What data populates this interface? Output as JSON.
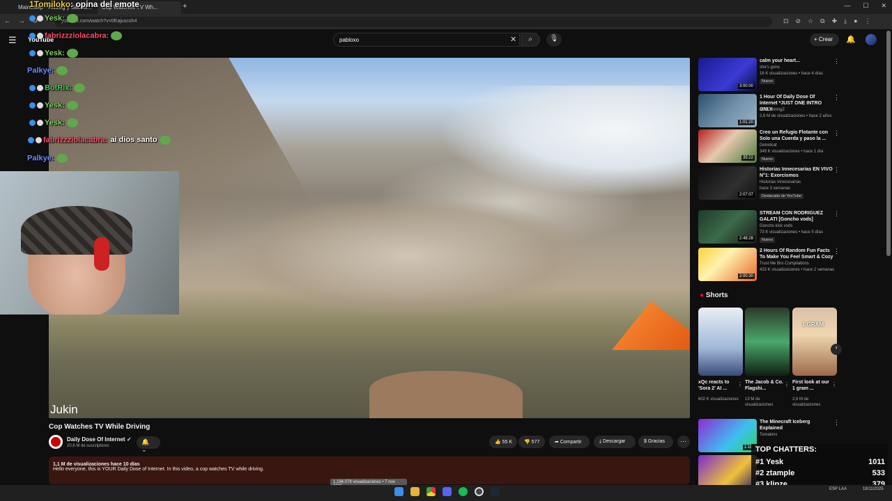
{
  "browser": {
    "tab1": "Maincitiep - Rizzeg y Sacha...",
    "tab2": "Cop Watches TV Wh...",
    "new_tab": "+",
    "url": "youtube.com/watch?v=0Eajuxcoh4",
    "window_controls": [
      "—",
      "☐",
      "✕"
    ]
  },
  "youtube": {
    "logo": "YouTube",
    "search_value": "pabloxo",
    "create_label": "Crear"
  },
  "chat": {
    "title_line": {
      "user": "1Tomiloko",
      "msg": "opina del emote"
    },
    "lines": [
      {
        "user": "Yesk:",
        "color": "#7fd05c"
      },
      {
        "user": "fabrizzziolacabra:",
        "color": "#ff4f6a"
      },
      {
        "user": "Yesk:",
        "color": "#7fd05c"
      },
      {
        "user": "Palkye:",
        "color": "#6b8cff"
      },
      {
        "user": "BotRix:",
        "color": "#4ecb58"
      },
      {
        "user": "Yesk:",
        "color": "#7fd05c"
      },
      {
        "user": "Yesk:",
        "color": "#7fd05c"
      },
      {
        "user": "fabrizzziolacabra:",
        "color": "#ff4f6a",
        "msg": "ai dios santo"
      },
      {
        "user": "Palkye:",
        "color": "#6b8cff"
      }
    ]
  },
  "video": {
    "watermark": "Jukin",
    "title": "Cop Watches TV While Driving",
    "channel": "Daily Dose Of Internet",
    "subs": "20,6 M de suscriptores",
    "likes": "55 K",
    "dislikes": "577",
    "share": "Compartir",
    "download": "Descargar",
    "thanks": "Gracias",
    "desc_views": "1,1 M de visualizaciones  hace 10 días",
    "desc_text": "Hello everyone, this is YOUR Daily Dose of Internet. In this video, a cop watches TV while driving.",
    "tooltip": "1.194.079 visualizaciones • 7 nov 2025"
  },
  "recs": [
    {
      "title": "calm your heart...",
      "channel": "she's gone",
      "meta": "16 K visualizaciones • hace 4 días",
      "badge": "Nuevo",
      "dur": "3:00:00",
      "bg": "linear-gradient(135deg,#1a1a8f,#3b3bd6 60%,#0a0a40)"
    },
    {
      "title": "1 Hour Of Daily Dose Of Internet *JUST ONE INTRO ONLY",
      "channel": "JDXGamingZ",
      "meta": "2,6 M de visualizaciones • hace 2 años",
      "badge": "",
      "dur": "1:01:20",
      "bg": "linear-gradient(135deg,#2a4f6e,#6f8fa8 50%,#9bb2c4)"
    },
    {
      "title": "Creo un Refugio Flotante con Solo una Cuerda y paso la ...",
      "channel": "Delvidcat",
      "meta": "349 K visualizaciones • hace 1 día",
      "badge": "Nuevo",
      "dur": "35:22",
      "bg": "linear-gradient(135deg,#b32020,#e6c9b0 45%,#4d7a3a)"
    },
    {
      "title": "Historias Innecesarias EN VIVO N°1: Exorcismos",
      "channel": "Historias Innecesarias",
      "meta": "hace 3 semanas",
      "badge": "Destacado de YouTube",
      "dur": "2:07:07",
      "bg": "linear-gradient(135deg,#0b0b0b,#303030 60%,#111)"
    },
    {
      "title": "STREAM CON RODRIGUEZ GALATI [Goncho vods]",
      "channel": "Goncho kick vods",
      "meta": "73 K visualizaciones • hace 5 días",
      "badge": "Nuevo",
      "dur": "2:48:28",
      "bg": "linear-gradient(135deg,#1f3a2a,#3c6b4a 50%,#1a1a1a)"
    },
    {
      "title": "2 Hours Of Random Fun Facts To Make You Feel Smart & Cozy",
      "channel": "Trust Me Bro Compilations",
      "meta": "423 K visualizaciones • hace 2 semanas",
      "badge": "",
      "dur": "2:00:30",
      "bg": "linear-gradient(135deg,#ffd23a,#fff2b0 40%,#e86a2a)"
    },
    {
      "title": "The Minecraft Iceberg Explained",
      "channel": "Tomakins",
      "meta": "",
      "badge": "",
      "dur": "1:18:",
      "bg": "linear-gradient(135deg,#8f2bd6,#3ec0f0 60%,#2ad26a)"
    },
    {
      "title": "",
      "channel": "",
      "meta": "",
      "badge": "",
      "dur": "",
      "bg": "linear-gradient(135deg,#7a2ad0,#f0c23a 60%,#2a1a60)"
    }
  ],
  "shorts": {
    "title": "Shorts",
    "items": [
      {
        "title": "xQc reacts to 'Sora 2' AI ...",
        "views": "602 K visualizaciones",
        "bg": "linear-gradient(180deg,#e8eef5,#9fb8d8 60%,#3a4a7a)"
      },
      {
        "title": "The Jacob & Co. Flagshi...",
        "views": "13 M de visualizaciones",
        "bg": "linear-gradient(180deg,#2b3a2a,#49a86a 50%,#0f1f12)"
      },
      {
        "title": "First look at our 1 gram ...",
        "views": "2,6 M de visualizaciones",
        "bg": "linear-gradient(180deg,#d9c1a8,#f0d6b0 40%,#9b6a4a)",
        "label": "1 GRAM"
      }
    ]
  },
  "top_chatters": {
    "title": "TOP CHATTERS:",
    "rows": [
      {
        "name": "#1 Yesk",
        "count": "1011"
      },
      {
        "name": "#2 ztample",
        "count": "533"
      },
      {
        "name": "#3 klipze",
        "count": "379"
      }
    ]
  },
  "taskbar": {
    "icons": [
      "windows",
      "folder",
      "chrome",
      "discord",
      "spotify",
      "obs",
      "steam"
    ],
    "tray_lang": "ESP LAA",
    "date": "18/11/2025"
  }
}
